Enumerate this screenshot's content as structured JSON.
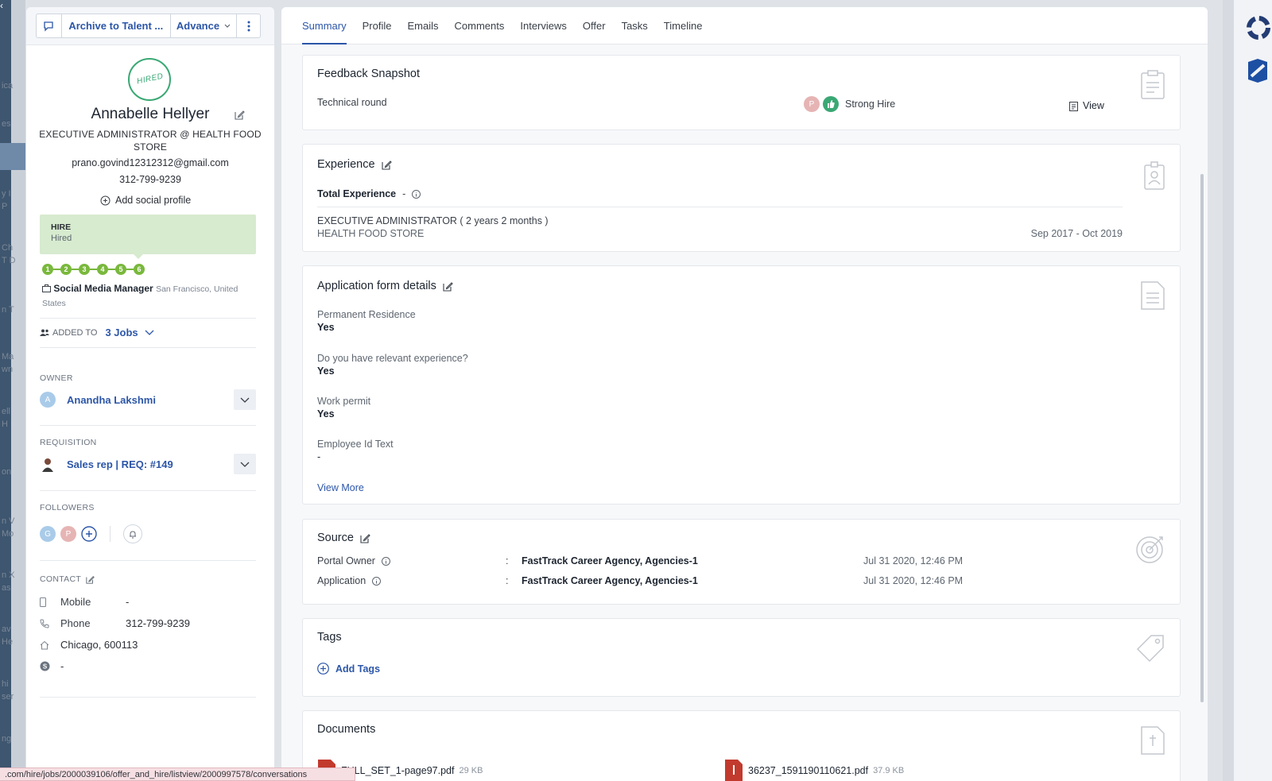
{
  "header_actions": {
    "archive_label": "Archive to Talent ...",
    "advance_label": "Advance"
  },
  "candidate": {
    "stamp": "HIRED",
    "name": "Annabelle Hellyer",
    "title": "EXECUTIVE ADMINISTRATOR @ HEALTH FOOD STORE",
    "email": "prano.govind12312312@gmail.com",
    "phone": "312-799-9239",
    "add_social": "Add social profile"
  },
  "stage": {
    "name": "HIRE",
    "status": "Hired",
    "steps": [
      "1",
      "2",
      "3",
      "4",
      "5",
      "6"
    ]
  },
  "job": {
    "title": "Social Media Manager",
    "location": "San Francisco, United States"
  },
  "added_to": {
    "label": "ADDED TO",
    "jobs": "3 Jobs"
  },
  "owner": {
    "label": "OWNER",
    "initial": "A",
    "name": "Anandha Lakshmi"
  },
  "requisition": {
    "label": "REQUISITION",
    "name": "Sales rep | REQ: #149"
  },
  "followers": {
    "label": "FOLLOWERS",
    "initials": [
      "G",
      "P"
    ]
  },
  "contact": {
    "label": "CONTACT",
    "mobile_label": "Mobile",
    "mobile": "-",
    "phone_label": "Phone",
    "phone": "312-799-9239",
    "address": "Chicago, 600113",
    "skype": "-"
  },
  "tabs": [
    "Summary",
    "Profile",
    "Emails",
    "Comments",
    "Interviews",
    "Offer",
    "Tasks",
    "Timeline"
  ],
  "feedback": {
    "title": "Feedback Snapshot",
    "round": "Technical round",
    "interviewer_initial": "P",
    "rating": "Strong Hire",
    "view_label": "View"
  },
  "experience": {
    "title": "Experience",
    "total_label": "Total Experience",
    "total_value": "-",
    "role": "EXECUTIVE ADMINISTRATOR ( 2 years 2 months )",
    "company": "HEALTH FOOD STORE",
    "dates": "Sep 2017 - Oct 2019"
  },
  "application_form": {
    "title": "Application form details",
    "fields": [
      {
        "label": "Permanent Residence",
        "value": "Yes"
      },
      {
        "label": "Do you have relevant experience?",
        "value": "Yes"
      },
      {
        "label": "Work permit",
        "value": "Yes"
      },
      {
        "label": "Employee Id Text",
        "value": "-"
      }
    ],
    "view_more": "View More"
  },
  "source": {
    "title": "Source",
    "rows": [
      {
        "label": "Portal Owner",
        "sep": ":",
        "value": "FastTrack Career Agency, Agencies-1",
        "date": "Jul 31 2020, 12:46 PM"
      },
      {
        "label": "Application",
        "sep": ":",
        "value": "FastTrack Career Agency, Agencies-1",
        "date": "Jul 31 2020, 12:46 PM"
      }
    ]
  },
  "tags": {
    "title": "Tags",
    "add_label": "Add Tags"
  },
  "documents": {
    "title": "Documents",
    "files": [
      {
        "name": "FULL_SET_1-page97.pdf",
        "size": "29 KB"
      },
      {
        "name": "36237_1591190110621.pdf",
        "size": "37.9 KB"
      }
    ]
  },
  "status_bar_url": ".com/hire/jobs/2000039106/offer_and_hire/listview/2000997578/conversations",
  "background_fragments": [
    "ica",
    "es",
    "y I",
    "P",
    "Ch",
    "T D",
    "n T",
    "Ma",
    "wn",
    "ell",
    "H",
    "on",
    "n V",
    "Mo",
    "n X",
    "as",
    "av",
    "He",
    "hi",
    "ser",
    "ng"
  ],
  "colors": {
    "accent": "#2c56a8",
    "hired": "#3aa874",
    "stage_bg": "#d7ebcf",
    "step": "#79b83c"
  }
}
